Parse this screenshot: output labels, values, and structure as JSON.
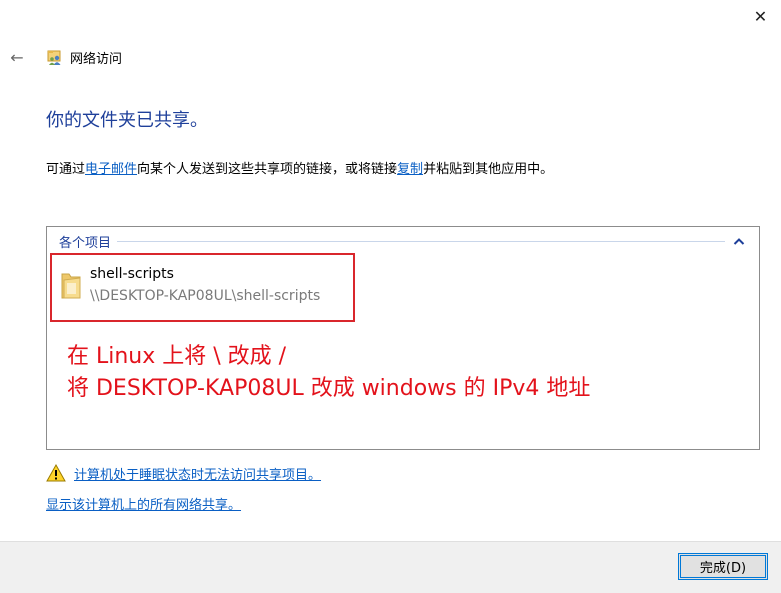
{
  "window": {
    "close_glyph": "✕",
    "back_glyph": "←",
    "title": "网络访问",
    "title_icon": "network-sharing-icon"
  },
  "main": {
    "heading": "你的文件夹已共享。",
    "instruction_prefix": "可通过",
    "email_link": "电子邮件",
    "instruction_middle": "向某个人发送到这些共享项的链接，或将链接",
    "copy_link": "复制",
    "instruction_suffix": "并粘贴到其他应用中。"
  },
  "items_panel": {
    "group_label": "各个项目",
    "collapse_icon": "chevron-up-icon",
    "items": [
      {
        "name": "shell-scripts",
        "path": "\\\\DESKTOP-KAP08UL\\shell-scripts",
        "icon": "folder-icon"
      }
    ],
    "annotation": [
      "在 Linux 上将 \\ 改成 /",
      "将 DESKTOP-KAP08UL 改成 windows 的 IPv4 地址"
    ],
    "annotation_color": "#e3121b",
    "highlight_color": "#d9262c"
  },
  "links": {
    "sleep_warning": "计算机处于睡眠状态时无法访问共享项目。",
    "show_all": "显示该计算机上的所有网络共享。"
  },
  "footer": {
    "done_label": "完成(D)"
  },
  "colors": {
    "heading": "#1e3f9a",
    "link": "#0a5fc4",
    "accent": "#0078d7"
  }
}
